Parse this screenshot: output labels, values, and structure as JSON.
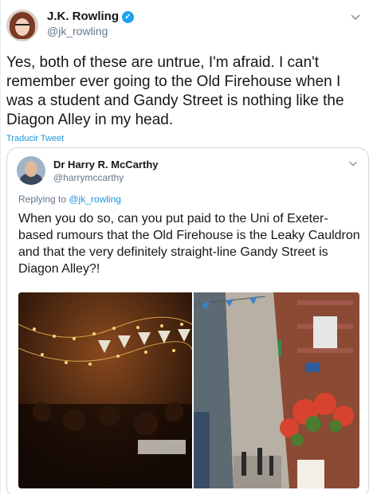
{
  "tweet": {
    "author_name": "J.K. Rowling",
    "author_handle": "@jk_rowling",
    "verified_symbol": "✓",
    "text": "Yes, both of these are untrue, I'm afraid. I can't remember ever going to the Old Firehouse when I was a student and Gandy Street is nothing like the Diagon Alley in my head.",
    "translate_label": "Traducir Tweet",
    "menu_icon": "chevron-down-icon"
  },
  "quoted_tweet": {
    "author_name": "Dr Harry R. McCarthy",
    "author_handle": "@harrymccarthy",
    "replying_prefix": "Replying to ",
    "replying_handle": "@jk_rowling",
    "text": "When you do so, can you put paid to the Uni of Exeter-based rumours that the Old Firehouse is the Leaky Cauldron and that the very definitely straight-line Gandy Street is Diagon Alley?!",
    "menu_icon": "chevron-down-icon",
    "photos": [
      "pub-interior-photo",
      "narrow-street-photo"
    ]
  },
  "colors": {
    "accent": "#1da1f2",
    "link": "#1b95e0",
    "secondary_text": "#657786",
    "border": "#ccd6dd"
  }
}
